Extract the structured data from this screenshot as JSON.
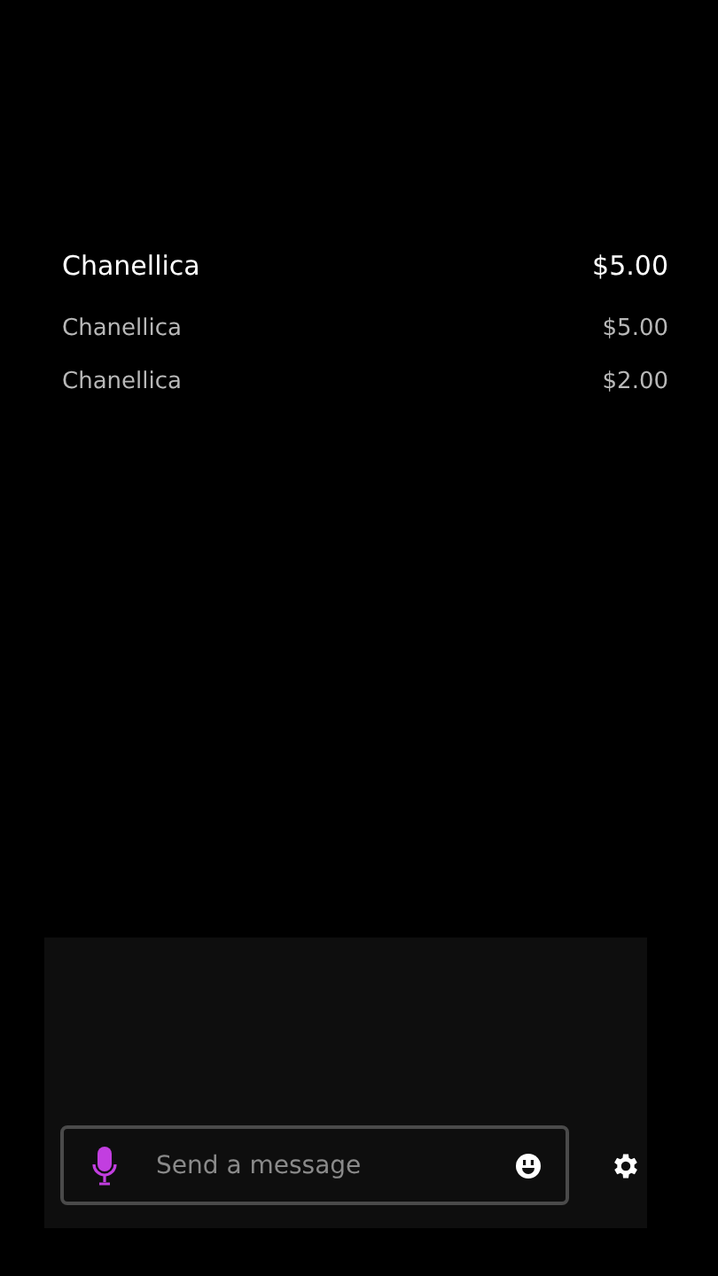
{
  "leaderboard": [
    {
      "kind": "top",
      "name": "Chanellica",
      "amount": "$5.00"
    },
    {
      "kind": "entry",
      "name": "Chanellica",
      "amount": "$5.00"
    },
    {
      "kind": "entry",
      "name": "Chanellica",
      "amount": "$2.00"
    }
  ],
  "chat": {
    "placeholder": "Send a message"
  }
}
